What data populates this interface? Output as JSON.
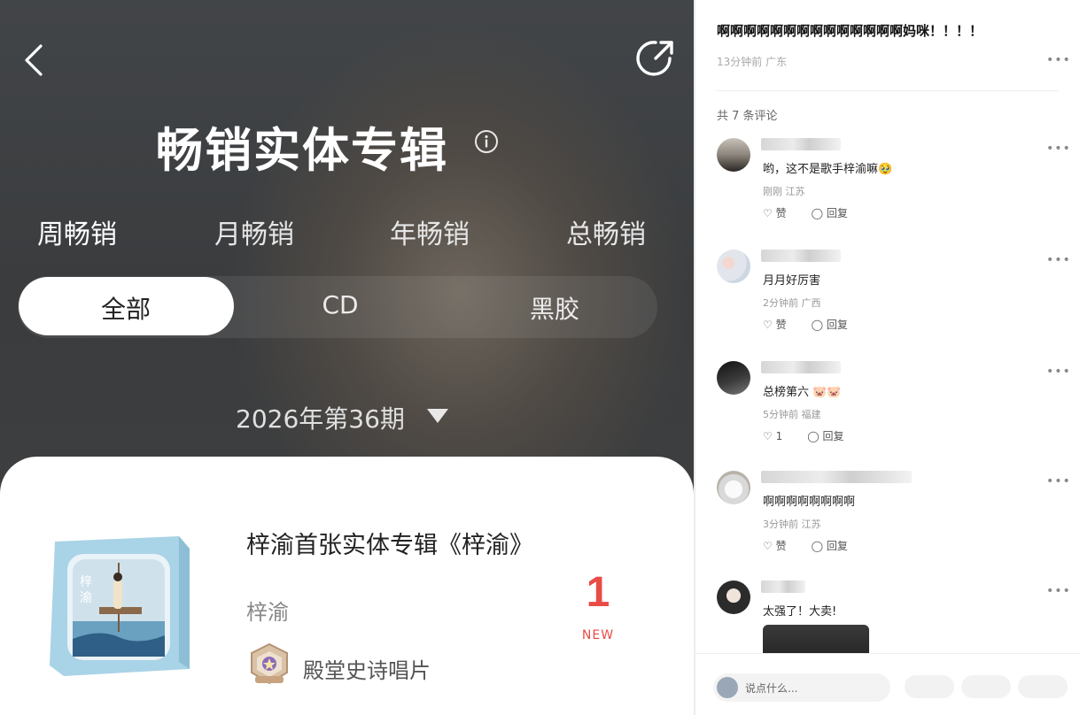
{
  "left_panel": {
    "title": "畅销实体专辑",
    "tabs": [
      {
        "label": "周畅销",
        "active": true
      },
      {
        "label": "月畅销",
        "active": false
      },
      {
        "label": "年畅销",
        "active": false
      },
      {
        "label": "总畅销",
        "active": false
      }
    ],
    "segments": [
      {
        "label": "全部",
        "active": true
      },
      {
        "label": "CD",
        "active": false
      },
      {
        "label": "黑胶",
        "active": false
      }
    ],
    "period": "2026年第36期",
    "album": {
      "title": "梓渝首张实体专辑《梓渝》",
      "artist": "梓渝",
      "rank": "1",
      "rank_tag": "NEW",
      "badge": "殿堂史诗唱片"
    },
    "accent_color": "#e94b47"
  },
  "right_panel": {
    "post_title": "啊啊啊啊啊啊啊啊啊啊啊啊啊啊妈咪！！！！",
    "post_meta": "13分钟前  广东",
    "comment_count": "共 7 条评论",
    "comments": [
      {
        "text": "哟，这不是歌手梓渝嘛🥹",
        "meta": "刚刚 江苏",
        "like": "赞",
        "reply": "回复"
      },
      {
        "text": "月月好厉害",
        "meta": "2分钟前 广西",
        "like": "赞",
        "reply": "回复"
      },
      {
        "text": "总榜第六 🐷🐷",
        "meta": "5分钟前 福建",
        "like": "1",
        "reply": "回复"
      },
      {
        "text": "啊啊啊啊啊啊啊啊",
        "meta": "3分钟前 江苏",
        "like": "赞",
        "reply": "回复"
      },
      {
        "text": "太强了！大卖!",
        "meta": "",
        "like": "",
        "reply": ""
      }
    ],
    "input_placeholder": "说点什么..."
  }
}
